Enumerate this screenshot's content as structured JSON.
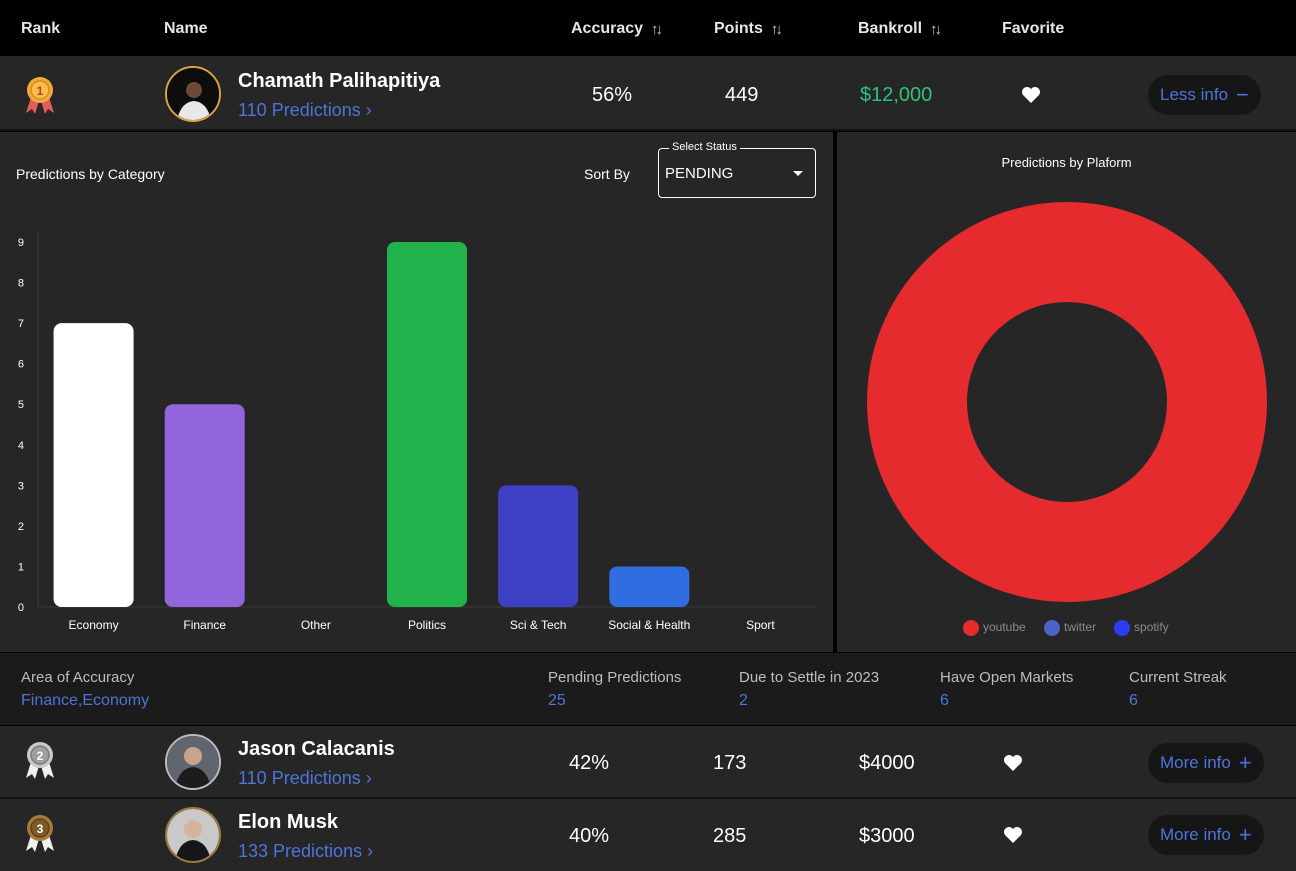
{
  "header": {
    "rank": "Rank",
    "name": "Name",
    "accuracy": "Accuracy",
    "points": "Points",
    "bankroll": "Bankroll",
    "favorite": "Favorite"
  },
  "rows": [
    {
      "rank": 1,
      "name": "Chamath Palihapitiya",
      "predictions": "110  Predictions",
      "accuracy": "56%",
      "points": "449",
      "bankroll": "$12,000",
      "bankroll_color": "#2ec27e",
      "button": "Less info",
      "button_symbol": "−",
      "favorite": true
    },
    {
      "rank": 2,
      "name": "Jason Calacanis",
      "predictions": "110 Predictions",
      "accuracy": "42%",
      "points": "173",
      "bankroll": "$4000",
      "bankroll_color": "#ffffff",
      "button": "More info",
      "button_symbol": "+",
      "favorite": true
    },
    {
      "rank": 3,
      "name": "Elon Musk",
      "predictions": "133 Predictions",
      "accuracy": "40%",
      "points": "285",
      "bankroll": "$3000",
      "bankroll_color": "#ffffff",
      "button": "More info",
      "button_symbol": "+",
      "favorite": true
    }
  ],
  "detail": {
    "sort_by": "Sort By",
    "select_label": "Select Status",
    "select_value": "PENDING"
  },
  "chart_data": [
    {
      "type": "bar",
      "title": "Predictions by Category",
      "categories": [
        "Economy",
        "Finance",
        "Other",
        "Politics",
        "Sci & Tech",
        "Social & Health",
        "Sport"
      ],
      "values": [
        7,
        5,
        0,
        9,
        3,
        1,
        0
      ],
      "colors": [
        "#ffffff",
        "#9265dc",
        "#888888",
        "#21b24b",
        "#3d40c4",
        "#2f6de0",
        "#888888"
      ],
      "ylim": [
        0,
        9
      ],
      "yticks": [
        "0",
        "1",
        "2",
        "3",
        "4",
        "5",
        "6",
        "7",
        "8",
        "9"
      ],
      "grid": false,
      "legend": "none"
    },
    {
      "type": "pie",
      "title": "Predictions by Plaform",
      "labels": [
        "youtube",
        "twitter",
        "spotify"
      ],
      "values": [
        110,
        0,
        0
      ],
      "colors": [
        "#e62b2e",
        "#4a65c6",
        "#2b3cf2"
      ],
      "donut": true,
      "legend": "bottom"
    }
  ],
  "stats": {
    "area_label": "Area of Accuracy",
    "area_value": "Finance,Economy",
    "pending_label": "Pending Predictions",
    "pending_value": "25",
    "settle_label": "Due to Settle in 2023",
    "settle_value": "2",
    "open_label": "Have Open Markets",
    "open_value": "6",
    "streak_label": "Current Streak",
    "streak_value": "6"
  }
}
